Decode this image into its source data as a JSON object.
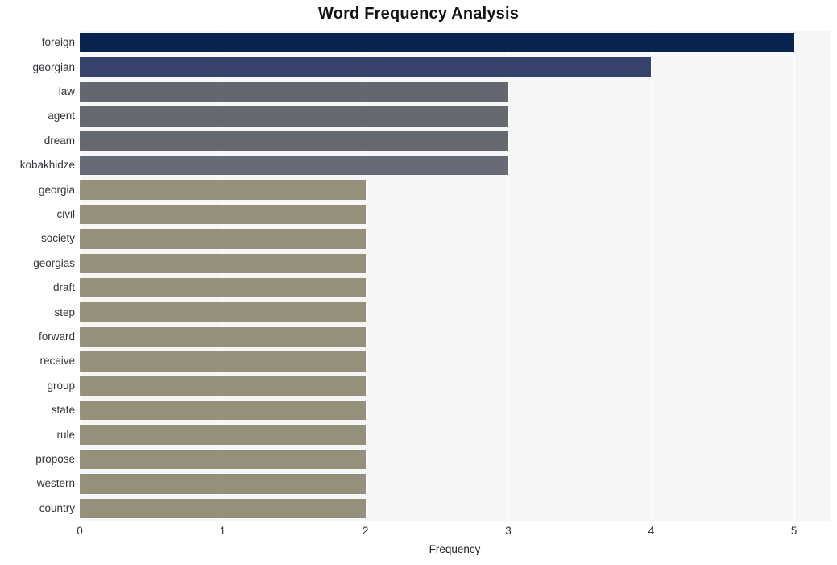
{
  "chart_data": {
    "type": "bar",
    "orientation": "horizontal",
    "title": "Word Frequency Analysis",
    "xlabel": "Frequency",
    "ylabel": "",
    "xlim": [
      0,
      5.25
    ],
    "xticks": [
      "0",
      "1",
      "2",
      "3",
      "4",
      "5"
    ],
    "xtick_values": [
      0,
      1,
      2,
      3,
      4,
      5
    ],
    "grid": "vertical",
    "legend": "none",
    "categories": [
      "foreign",
      "georgian",
      "law",
      "agent",
      "dream",
      "kobakhidze",
      "georgia",
      "civil",
      "society",
      "georgias",
      "draft",
      "step",
      "forward",
      "receive",
      "group",
      "state",
      "rule",
      "propose",
      "western",
      "country"
    ],
    "values": [
      5,
      4,
      3,
      3,
      3,
      3,
      2,
      2,
      2,
      2,
      2,
      2,
      2,
      2,
      2,
      2,
      2,
      2,
      2,
      2
    ],
    "bar_colors": [
      "#06244d",
      "#37436d",
      "#63676f",
      "#64686f",
      "#64686f",
      "#676b78",
      "#95907c",
      "#95907c",
      "#95907c",
      "#95907c",
      "#95907c",
      "#95907c",
      "#95907c",
      "#95907c",
      "#95907c",
      "#95907c",
      "#95907c",
      "#95907c",
      "#95907c",
      "#95907c"
    ],
    "plot_background": "#f6f6f7",
    "figure_background": "#ffffff",
    "gridline_color": "#ffffff",
    "text_color": "#33333a"
  }
}
